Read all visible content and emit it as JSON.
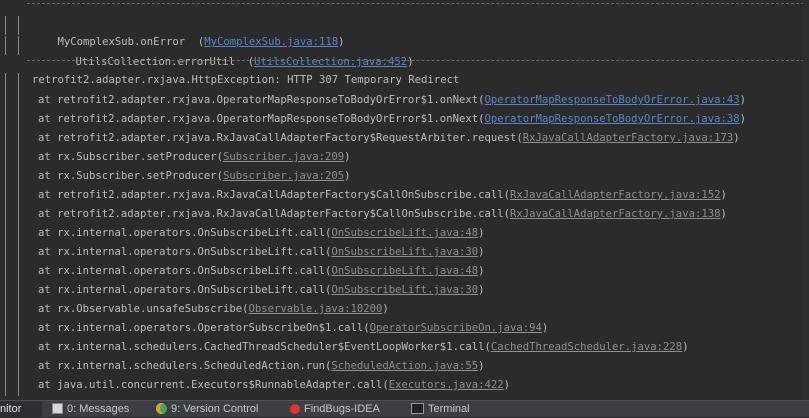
{
  "console": {
    "top_block": [
      {
        "text": "MyComplexSub.onError  (",
        "link": "MyComplexSub.java:118",
        "close": ")"
      },
      {
        "text": "UtilsCollection.errorUtil  (",
        "link": "UtilsCollection.java:452",
        "close": ")"
      }
    ],
    "exception": "retrofit2.adapter.rxjava.HttpException: HTTP 307 Temporary Redirect",
    "frames": [
      {
        "text": "at retrofit2.adapter.rxjava.OperatorMapResponseToBodyOrError$1.onNext(",
        "link": "OperatorMapResponseToBodyOrError.java:43",
        "close": ")"
      },
      {
        "text": "at retrofit2.adapter.rxjava.OperatorMapResponseToBodyOrError$1.onNext(",
        "link": "OperatorMapResponseToBodyOrError.java:38",
        "close": ")"
      },
      {
        "text": "at retrofit2.adapter.rxjava.RxJavaCallAdapterFactory$RequestArbiter.request(",
        "link": "RxJavaCallAdapterFactory.java:173",
        "close": ")"
      },
      {
        "text": "at rx.Subscriber.setProducer(",
        "link": "Subscriber.java:209",
        "close": ")"
      },
      {
        "text": "at rx.Subscriber.setProducer(",
        "link": "Subscriber.java:205",
        "close": ")"
      },
      {
        "text": "at retrofit2.adapter.rxjava.RxJavaCallAdapterFactory$CallOnSubscribe.call(",
        "link": "RxJavaCallAdapterFactory.java:152",
        "close": ")"
      },
      {
        "text": "at retrofit2.adapter.rxjava.RxJavaCallAdapterFactory$CallOnSubscribe.call(",
        "link": "RxJavaCallAdapterFactory.java:138",
        "close": ")"
      },
      {
        "text": "at rx.internal.operators.OnSubscribeLift.call(",
        "link": "OnSubscribeLift.java:48",
        "close": ")"
      },
      {
        "text": "at rx.internal.operators.OnSubscribeLift.call(",
        "link": "OnSubscribeLift.java:30",
        "close": ")"
      },
      {
        "text": "at rx.internal.operators.OnSubscribeLift.call(",
        "link": "OnSubscribeLift.java:48",
        "close": ")"
      },
      {
        "text": "at rx.internal.operators.OnSubscribeLift.call(",
        "link": "OnSubscribeLift.java:30",
        "close": ")"
      },
      {
        "text": "at rx.Observable.unsafeSubscribe(",
        "link": "Observable.java:10200",
        "close": ")"
      },
      {
        "text": "at rx.internal.operators.OperatorSubscribeOn$1.call(",
        "link": "OperatorSubscribeOn.java:94",
        "close": ")"
      },
      {
        "text": "at rx.internal.schedulers.CachedThreadScheduler$EventLoopWorker$1.call(",
        "link": "CachedThreadScheduler.java:228",
        "close": ")"
      },
      {
        "text": "at rx.internal.schedulers.ScheduledAction.run(",
        "link": "ScheduledAction.java:55",
        "close": ")"
      },
      {
        "text": "at java.util.concurrent.Executors$RunnableAdapter.call(",
        "link": "Executors.java:422",
        "close": ")"
      }
    ]
  },
  "statusbar": {
    "active_tab": "nitor",
    "tabs": [
      {
        "label": "0: Messages",
        "icon": "messages-icon"
      },
      {
        "label": "9: Version Control",
        "icon": "version-control-icon"
      },
      {
        "label": "FindBugs-IDEA",
        "icon": "findbugs-icon"
      },
      {
        "label": "Terminal",
        "icon": "terminal-icon"
      }
    ]
  }
}
